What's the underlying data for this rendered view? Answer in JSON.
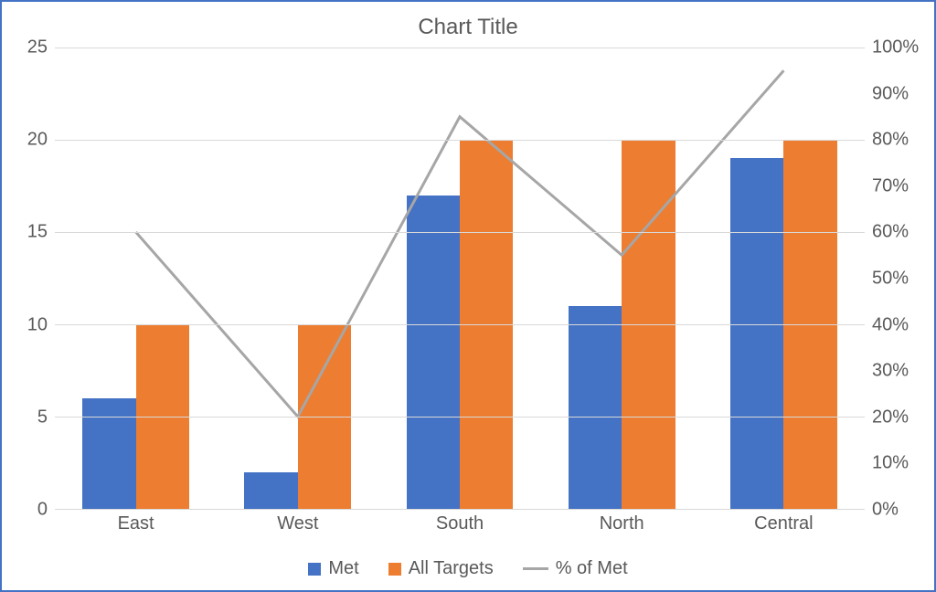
{
  "title": "Chart Title",
  "legend": {
    "met": "Met",
    "all_targets": "All Targets",
    "pct_met": "% of Met"
  },
  "axes": {
    "left_ticks": [
      "0",
      "5",
      "10",
      "15",
      "20",
      "25"
    ],
    "right_ticks": [
      "0%",
      "10%",
      "20%",
      "30%",
      "40%",
      "50%",
      "60%",
      "70%",
      "80%",
      "90%",
      "100%"
    ]
  },
  "categories": [
    "East",
    "West",
    "South",
    "North",
    "Central"
  ],
  "chart_data": {
    "type": "bar",
    "title": "Chart Title",
    "categories": [
      "East",
      "West",
      "South",
      "North",
      "Central"
    ],
    "series": [
      {
        "name": "Met",
        "kind": "bar",
        "axis": "left",
        "color": "#4472C4",
        "values": [
          6,
          2,
          17,
          11,
          19
        ]
      },
      {
        "name": "All Targets",
        "kind": "bar",
        "axis": "left",
        "color": "#ED7D31",
        "values": [
          10,
          10,
          20,
          20,
          20
        ]
      },
      {
        "name": "% of Met",
        "kind": "line",
        "axis": "right",
        "color": "#A6A6A6",
        "values": [
          0.6,
          0.2,
          0.85,
          0.55,
          0.95
        ]
      }
    ],
    "xlabel": "",
    "ylabel_left": "",
    "ylabel_right": "",
    "ylim_left": [
      0,
      25
    ],
    "ylim_right": [
      0,
      1
    ],
    "grid": true,
    "legend_position": "bottom"
  }
}
